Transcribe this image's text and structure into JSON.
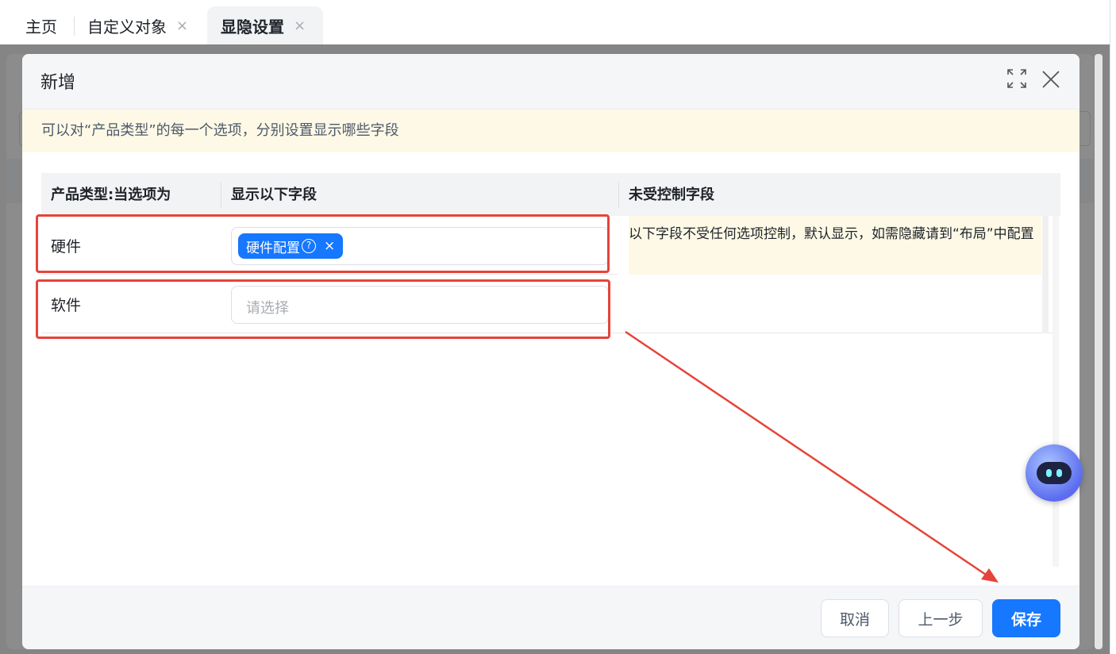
{
  "tabs": {
    "home": "主页",
    "custom_object": "自定义对象",
    "active": "显隐设置",
    "close_glyph": "×"
  },
  "dialog": {
    "title": "新增",
    "notice": "可以对“产品类型”的每一个选项，分别设置显示哪些字段",
    "columns": {
      "option": "产品类型:当选项为",
      "show_fields": "显示以下字段",
      "uncontrolled": "未受控制字段"
    },
    "rows": [
      {
        "label": "硬件",
        "tag": "硬件配置",
        "tag_help": "?",
        "tag_remove": "×"
      },
      {
        "label": "软件",
        "placeholder": "请选择"
      }
    ],
    "uncontrolled_note": "以下字段不受任何选项控制，默认显示，如需隐藏请到“布局”中配置",
    "buttons": {
      "cancel": "取消",
      "prev": "上一步",
      "save": "保存"
    }
  },
  "colors": {
    "primary": "#1677ff",
    "annotation": "#e5443a",
    "notice_bg": "#fdf9e6"
  },
  "icons": [
    "expand-icon",
    "close-icon",
    "robot-assistant-icon",
    "help-circle-icon"
  ]
}
